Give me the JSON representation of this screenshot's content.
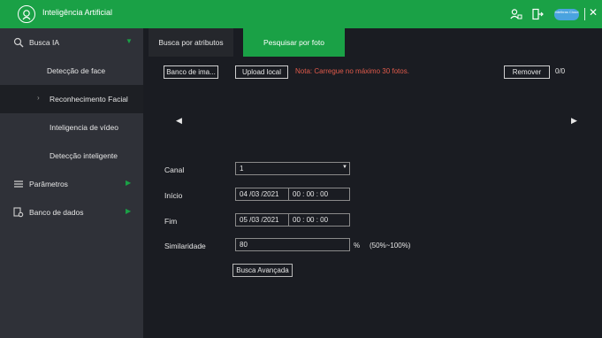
{
  "app": {
    "title": "Inteligência Artificial",
    "cloud_badge": "Intelbras Cloud",
    "close": "✕"
  },
  "sidebar": {
    "items": [
      {
        "label": "Busca IA",
        "icon": "face-search-icon"
      },
      {
        "label": "Detecção de face"
      },
      {
        "label": "Reconhecimento Facial"
      },
      {
        "label": "Inteligencia de vídeo"
      },
      {
        "label": "Detecção inteligente"
      },
      {
        "label": "Parâmetros",
        "icon": "list-icon"
      },
      {
        "label": "Banco de dados",
        "icon": "database-icon"
      }
    ]
  },
  "tabs": [
    {
      "label": "Busca por atributos"
    },
    {
      "label": "Pesquisar por foto"
    }
  ],
  "toolbar": {
    "banco": "Banco de ima...",
    "upload": "Upload local",
    "note": "Nota: Carregue no máximo 30 fotos.",
    "remove": "Remover",
    "count": "0/0"
  },
  "form": {
    "canal": {
      "label": "Canal",
      "value": "1"
    },
    "inicio": {
      "label": "Início",
      "date": "04 /03 /2021",
      "time": "00 : 00 : 00"
    },
    "fim": {
      "label": "Fim",
      "date": "05 /03 /2021",
      "time": "00 : 00 : 00"
    },
    "similaridade": {
      "label": "Similaridade",
      "value": "80",
      "unit": "%",
      "range": "(50%~100%)"
    },
    "advanced": "Busca Avançada"
  },
  "colors": {
    "accent": "#1aa146",
    "note": "#e05a4b",
    "sidebar": "#2f3138",
    "background": "#1a1c22"
  }
}
